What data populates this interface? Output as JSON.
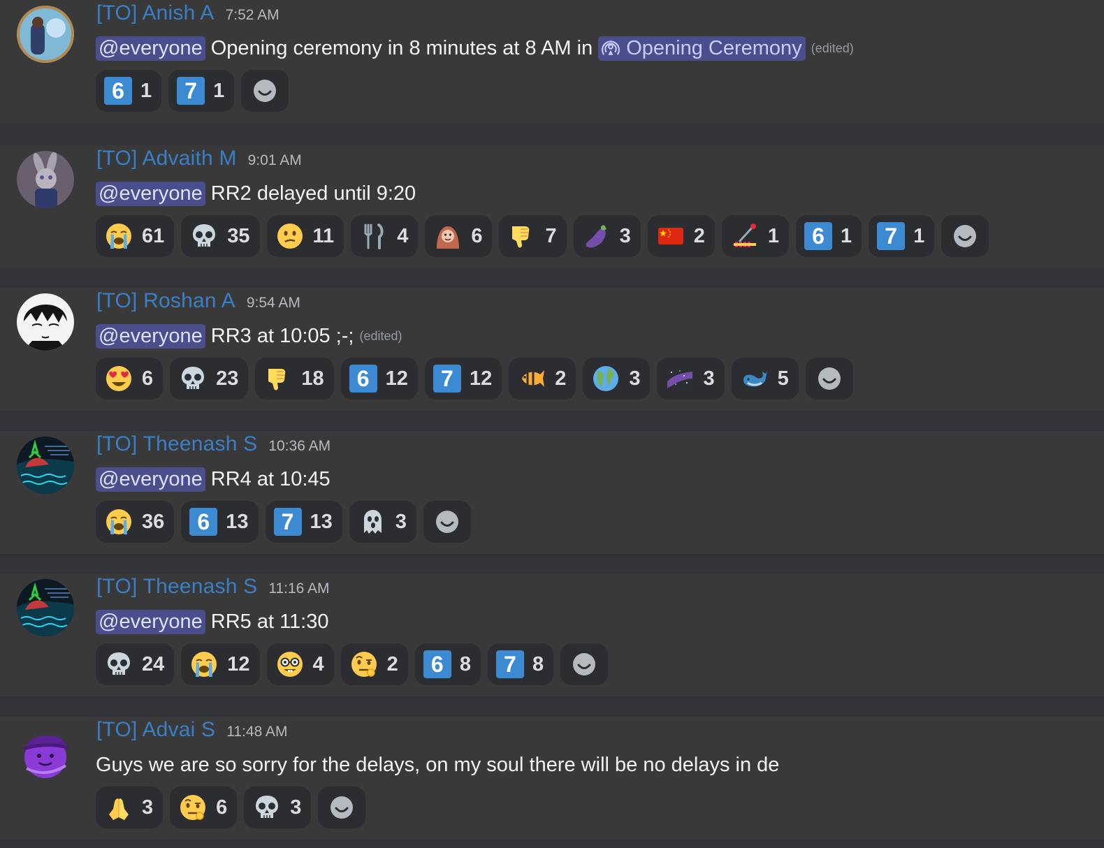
{
  "colors": {
    "background": "#313338",
    "message_background": "#393939",
    "author_color": "#3a7fc6",
    "mention_background": "#4a4e8d",
    "reaction_background": "#2b2d31",
    "keycap_blue": "#3c8ad2"
  },
  "messages": [
    {
      "author": "[TO] Anish A",
      "time": "7:52 AM",
      "avatar": "blue-blob-avatar",
      "mention": "@everyone",
      "text": "Opening ceremony in 8 minutes at 8 AM in",
      "channel": {
        "icon": "stage-channel-icon",
        "name": "Opening Ceremony"
      },
      "edited": "(edited)",
      "reactions": [
        {
          "emoji": "6",
          "kind": "keycap",
          "icon": "keycap-6-icon",
          "count": "1"
        },
        {
          "emoji": "7",
          "kind": "keycap",
          "icon": "keycap-7-icon",
          "count": "1"
        }
      ],
      "add_reaction_icon": "add-reaction-smiley-icon"
    },
    {
      "author": "[TO] Advaith M",
      "time": "9:01 AM",
      "avatar": "bunny-character-avatar",
      "mention": "@everyone",
      "text": "RR2 delayed until 9:20",
      "edited": "",
      "reactions": [
        {
          "emoji": "😭",
          "kind": "emoji",
          "icon": "loudly-crying-face-icon",
          "count": "61"
        },
        {
          "emoji": "💀",
          "kind": "emoji",
          "icon": "skull-icon",
          "count": "35"
        },
        {
          "emoji": "😕",
          "kind": "emoji",
          "icon": "confused-face-icon",
          "count": "11"
        },
        {
          "emoji": "🍴",
          "kind": "emoji",
          "icon": "fork-and-knife-icon",
          "count": "4"
        },
        {
          "emoji": "🦧",
          "kind": "emoji",
          "icon": "orangutan-icon",
          "count": "6"
        },
        {
          "emoji": "👎",
          "kind": "emoji",
          "icon": "thumbs-down-icon",
          "count": "7"
        },
        {
          "emoji": "🍆",
          "kind": "emoji",
          "icon": "eggplant-icon",
          "count": "3"
        },
        {
          "emoji": "🇨🇳",
          "kind": "emoji",
          "icon": "china-flag-icon",
          "count": "2"
        },
        {
          "emoji": "🎚",
          "kind": "custom",
          "icon": "slider-lever-icon",
          "count": "1"
        },
        {
          "emoji": "6",
          "kind": "keycap",
          "icon": "keycap-6-icon",
          "count": "1"
        },
        {
          "emoji": "7",
          "kind": "keycap",
          "icon": "keycap-7-icon",
          "count": "1"
        }
      ],
      "add_reaction_icon": "add-reaction-smiley-icon"
    },
    {
      "author": "[TO] Roshan A",
      "time": "9:54 AM",
      "avatar": "manga-face-avatar",
      "mention": "@everyone",
      "text": "RR3 at 10:05 ;-;",
      "edited": "(edited)",
      "reactions": [
        {
          "emoji": "😍",
          "kind": "emoji",
          "icon": "heart-eyes-icon",
          "count": "6"
        },
        {
          "emoji": "💀",
          "kind": "emoji",
          "icon": "skull-icon",
          "count": "23"
        },
        {
          "emoji": "👎",
          "kind": "emoji",
          "icon": "thumbs-down-icon",
          "count": "18"
        },
        {
          "emoji": "6",
          "kind": "keycap",
          "icon": "keycap-6-icon",
          "count": "12"
        },
        {
          "emoji": "7",
          "kind": "keycap",
          "icon": "keycap-7-icon",
          "count": "12"
        },
        {
          "emoji": "🐠",
          "kind": "emoji",
          "icon": "tropical-fish-icon",
          "count": "2"
        },
        {
          "emoji": "🌍",
          "kind": "emoji",
          "icon": "globe-icon",
          "count": "3"
        },
        {
          "emoji": "🌌",
          "kind": "emoji",
          "icon": "milky-way-icon",
          "count": "3"
        },
        {
          "emoji": "🐳",
          "kind": "emoji",
          "icon": "whale-icon",
          "count": "5"
        }
      ],
      "add_reaction_icon": "add-reaction-smiley-icon"
    },
    {
      "author": "[TO] Theenash S",
      "time": "10:36 AM",
      "avatar": "neon-landscape-avatar",
      "mention": "@everyone",
      "text": "RR4 at 10:45",
      "edited": "",
      "reactions": [
        {
          "emoji": "😭",
          "kind": "emoji",
          "icon": "loudly-crying-face-icon",
          "count": "36"
        },
        {
          "emoji": "6",
          "kind": "keycap",
          "icon": "keycap-6-icon",
          "count": "13"
        },
        {
          "emoji": "7",
          "kind": "keycap",
          "icon": "keycap-7-icon",
          "count": "13"
        },
        {
          "emoji": "👻",
          "kind": "emoji",
          "icon": "ghost-icon",
          "count": "3"
        }
      ],
      "add_reaction_icon": "add-reaction-smiley-icon"
    },
    {
      "author": "[TO] Theenash S",
      "time": "11:16 AM",
      "avatar": "neon-landscape-avatar",
      "mention": "@everyone",
      "text": "RR5 at 11:30",
      "edited": "",
      "reactions": [
        {
          "emoji": "💀",
          "kind": "emoji",
          "icon": "skull-icon",
          "count": "24"
        },
        {
          "emoji": "😭",
          "kind": "emoji",
          "icon": "loudly-crying-face-icon",
          "count": "12"
        },
        {
          "emoji": "🤓",
          "kind": "emoji",
          "icon": "nerd-face-icon",
          "count": "4"
        },
        {
          "emoji": "🤨",
          "kind": "emoji",
          "icon": "raised-eyebrow-icon",
          "count": "2"
        },
        {
          "emoji": "6",
          "kind": "keycap",
          "icon": "keycap-6-icon",
          "count": "8"
        },
        {
          "emoji": "7",
          "kind": "keycap",
          "icon": "keycap-7-icon",
          "count": "8"
        }
      ],
      "add_reaction_icon": "add-reaction-smiley-icon"
    },
    {
      "author": "[TO] Advai S",
      "time": "11:48 AM",
      "avatar": "purple-blob-avatar",
      "mention": "",
      "text": "Guys we are so sorry for the delays, on my soul there will be no delays in de",
      "edited": "",
      "reactions": [
        {
          "emoji": "🙏",
          "kind": "emoji",
          "icon": "folded-hands-icon",
          "count": "3"
        },
        {
          "emoji": "🤨",
          "kind": "emoji",
          "icon": "raised-eyebrow-icon",
          "count": "6"
        },
        {
          "emoji": "💀",
          "kind": "emoji",
          "icon": "skull-icon",
          "count": "3"
        }
      ],
      "add_reaction_icon": "add-reaction-smiley-icon"
    }
  ]
}
